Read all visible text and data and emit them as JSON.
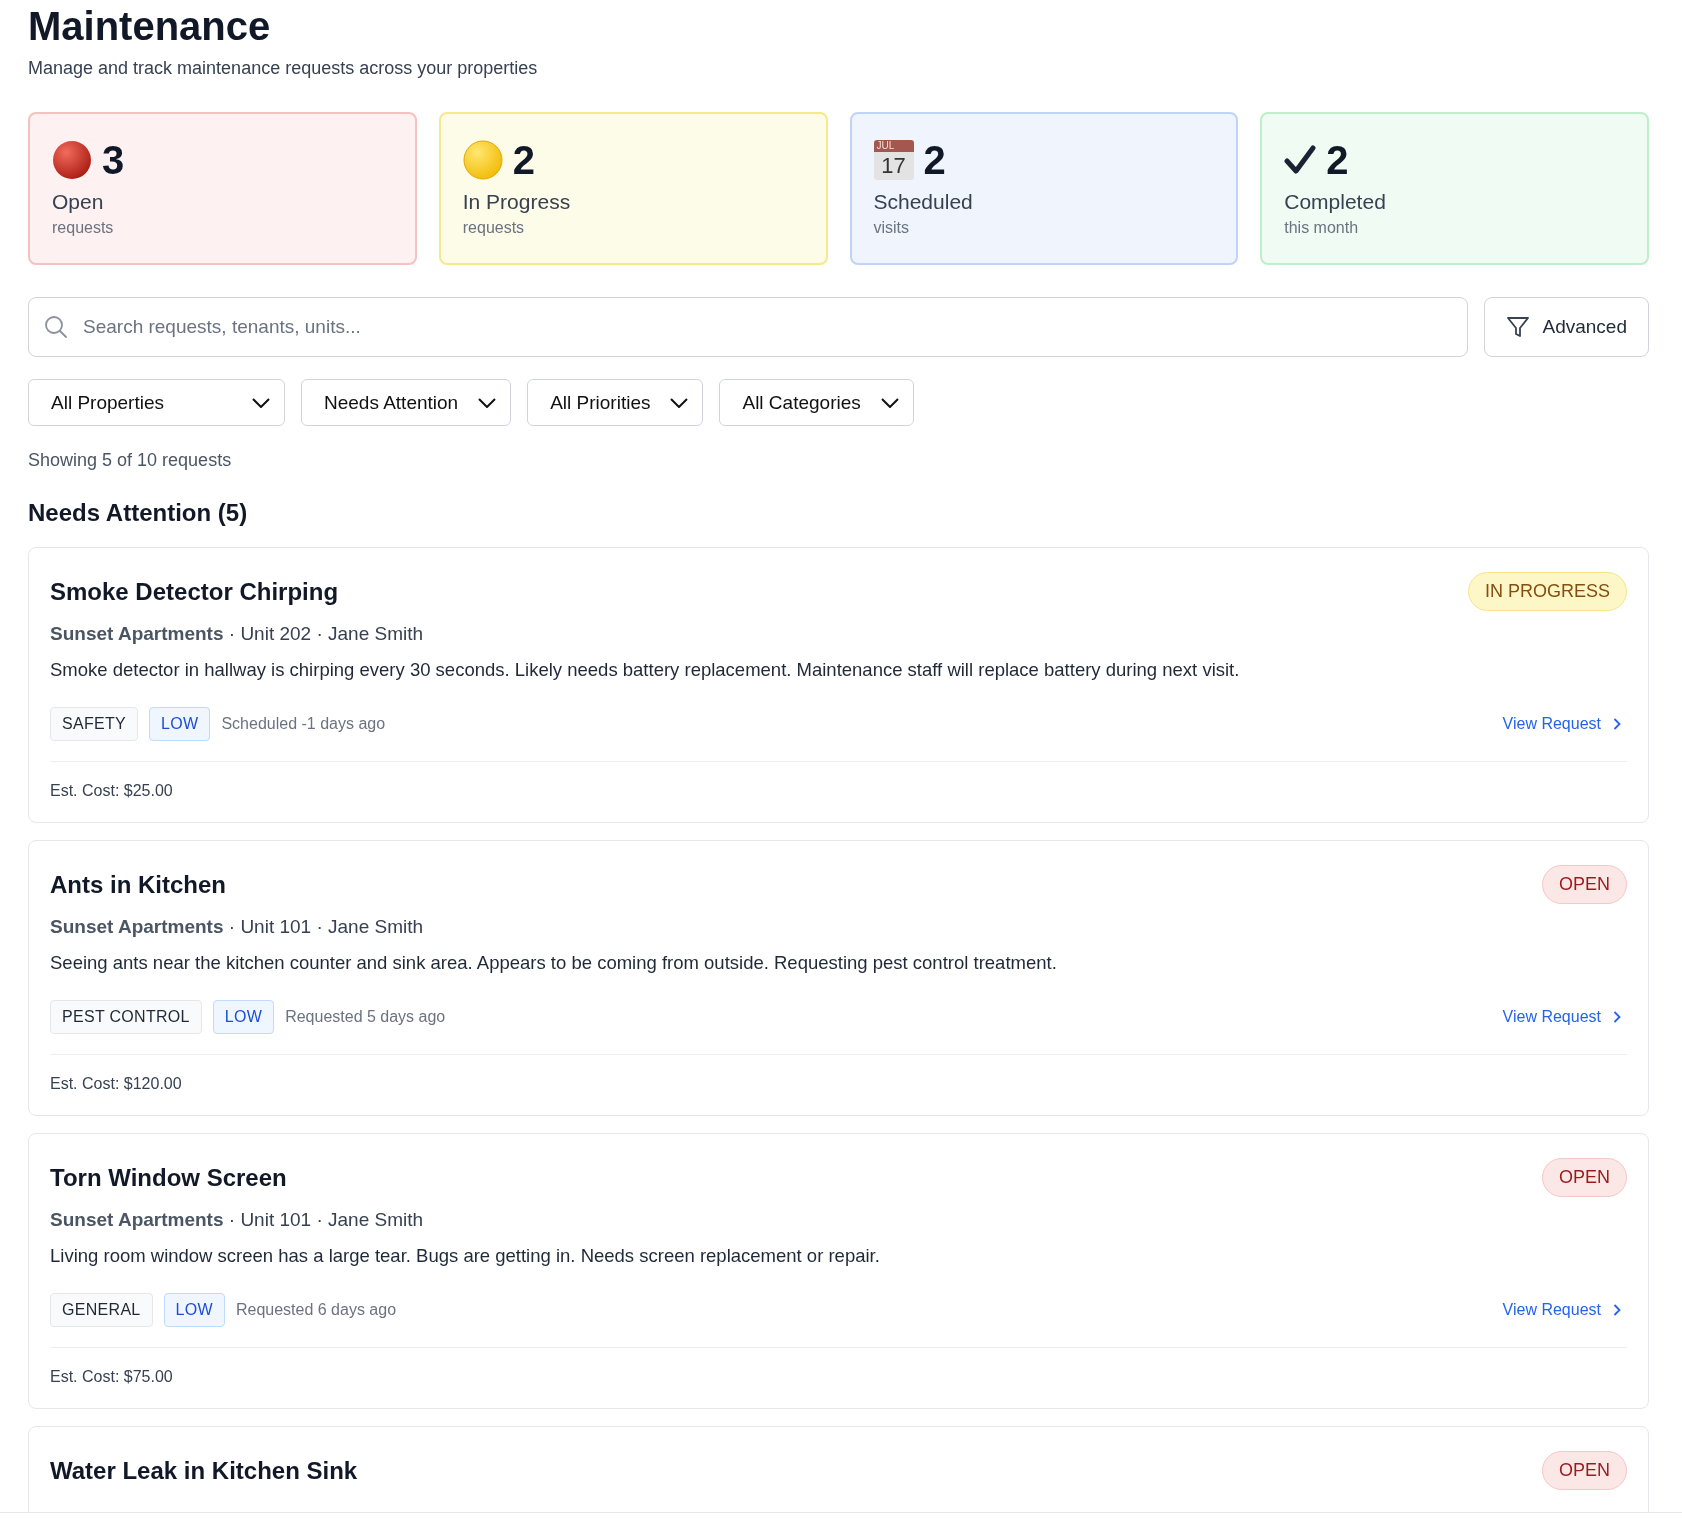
{
  "header": {
    "title": "Maintenance",
    "subtitle": "Manage and track maintenance requests across your properties"
  },
  "stats": [
    {
      "kind": "open",
      "value": "3",
      "label": "Open",
      "caption": "requests"
    },
    {
      "kind": "in_progress",
      "value": "2",
      "label": "In Progress",
      "caption": "requests"
    },
    {
      "kind": "scheduled",
      "value": "2",
      "label": "Scheduled",
      "caption": "visits",
      "icon_month": "JUL",
      "icon_day": "17"
    },
    {
      "kind": "completed",
      "value": "2",
      "label": "Completed",
      "caption": "this month"
    }
  ],
  "search": {
    "placeholder": "Search requests, tenants, units...",
    "button": "Advanced"
  },
  "filters": [
    {
      "value": "All Properties"
    },
    {
      "value": "Needs Attention"
    },
    {
      "value": "All Priorities"
    },
    {
      "value": "All Categories"
    }
  ],
  "result_count": "Showing 5 of 10 requests",
  "section_title": "Needs Attention (5)",
  "requests": [
    {
      "title": "Smoke Detector Chirping",
      "status": "IN PROGRESS",
      "kind": "in_progress",
      "property": "Sunset Apartments",
      "details": " · Unit 202 · Jane Smith",
      "description": "Smoke detector in hallway is chirping every 30 seconds. Likely needs battery replacement. Maintenance staff will replace battery during next visit.",
      "tags": [
        {
          "kind": "category",
          "text": "SAFETY"
        },
        {
          "kind": "priority",
          "text": "LOW"
        }
      ],
      "timing": "Scheduled -1 days ago",
      "link": "View Request",
      "cost": "Est. Cost: $25.00"
    },
    {
      "title": "Ants in Kitchen",
      "status": "OPEN",
      "kind": "open",
      "property": "Sunset Apartments",
      "details": " · Unit 101 · Jane Smith",
      "description": "Seeing ants near the kitchen counter and sink area. Appears to be coming from outside. Requesting pest control treatment.",
      "tags": [
        {
          "kind": "category",
          "text": "PEST CONTROL"
        },
        {
          "kind": "priority",
          "text": "LOW"
        }
      ],
      "timing": "Requested 5 days ago",
      "link": "View Request",
      "cost": "Est. Cost: $120.00"
    },
    {
      "title": "Torn Window Screen",
      "status": "OPEN",
      "kind": "open",
      "property": "Sunset Apartments",
      "details": " · Unit 101 · Jane Smith",
      "description": "Living room window screen has a large tear. Bugs are getting in. Needs screen replacement or repair.",
      "tags": [
        {
          "kind": "category",
          "text": "GENERAL"
        },
        {
          "kind": "priority",
          "text": "LOW"
        }
      ],
      "timing": "Requested 6 days ago",
      "link": "View Request",
      "cost": "Est. Cost: $75.00"
    },
    {
      "title": "Water Leak in Kitchen Sink",
      "status": "OPEN",
      "kind": "open"
    }
  ]
}
